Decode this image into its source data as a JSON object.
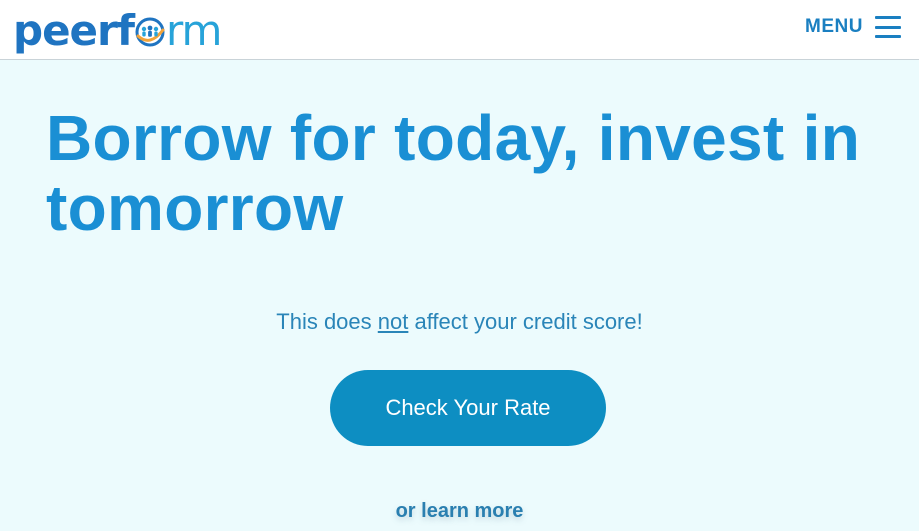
{
  "header": {
    "logo": {
      "part1": "peer",
      "part2": "f",
      "part3": "rm",
      "icon": "people-circle-logo-icon"
    },
    "menu_label": "MENU",
    "menu_icon": "hamburger-icon"
  },
  "hero": {
    "headline": "Borrow for today, invest in tomorrow",
    "subtext_before": "This does ",
    "subtext_emphasis": "not",
    "subtext_after": " affect your credit score!",
    "cta_label": "Check Your Rate",
    "learn_more": "or learn more"
  },
  "colors": {
    "background": "#ecfbfd",
    "header_background": "#ffffff",
    "brand_dark_blue": "#1f74c1",
    "brand_light_blue": "#27a3d9",
    "headline": "#1a8fd4",
    "cta_background": "#0d8ec2",
    "logo_accent": "#f2a33a"
  }
}
